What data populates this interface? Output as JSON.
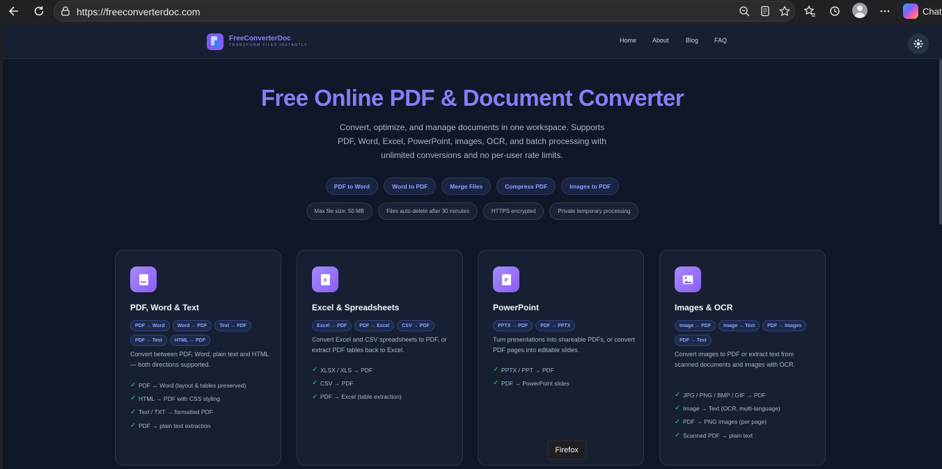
{
  "browser": {
    "url": "https://freeconverterdoc.com",
    "chat_label": "Chat"
  },
  "site": {
    "brand_name": "FreeConverterDoc",
    "brand_tagline": "TRANSFORM FILES INSTANTLY",
    "nav": [
      "Home",
      "About",
      "Blog",
      "FAQ"
    ]
  },
  "hero": {
    "title": "Free Online PDF & Document Converter",
    "subtitle": "Convert, optimize, and manage documents in one workspace. Supports PDF, Word, Excel, PowerPoint, images, OCR, and batch processing with unlimited conversions and no per-user rate limits.",
    "quick_links": [
      "PDF to Word",
      "Word to PDF",
      "Merge Files",
      "Compress PDF",
      "Images to PDF"
    ],
    "info_pills": [
      "Max file size: 50 MB",
      "Files auto-delete after 30 minutes",
      "HTTPS encrypted",
      "Private temporary processing"
    ]
  },
  "cards": [
    {
      "icon": "pdf-file-icon",
      "icon_text": "PDF",
      "title": "PDF, Word & Text",
      "tags": [
        "PDF → Word",
        "Word → PDF",
        "Text → PDF",
        "PDF → Text",
        "HTML → PDF"
      ],
      "description": "Convert between PDF, Word, plain text and HTML — both directions supported.",
      "features": [
        "PDF ↔ Word (layout & tables preserved)",
        "HTML → PDF with CSS styling",
        "Text / TXT → formatted PDF",
        "PDF → plain text extraction"
      ]
    },
    {
      "icon": "excel-file-icon",
      "icon_text": "X",
      "title": "Excel & Spreadsheets",
      "tags": [
        "Excel → PDF",
        "PDF → Excel",
        "CSV → PDF"
      ],
      "description": "Convert Excel and CSV spreadsheets to PDF, or extract PDF tables back to Excel.",
      "features": [
        "XLSX / XLS → PDF",
        "CSV → PDF",
        "PDF → Excel (table extraction)"
      ]
    },
    {
      "icon": "powerpoint-file-icon",
      "icon_text": "P",
      "title": "PowerPoint",
      "tags": [
        "PPTX → PDF",
        "PDF → PPTX"
      ],
      "description": "Turn presentations into shareable PDFs, or convert PDF pages into editable slides.",
      "features": [
        "PPTX / PPT → PDF",
        "PDF → PowerPoint slides"
      ]
    },
    {
      "icon": "image-icon",
      "icon_text": "",
      "title": "Images & OCR",
      "tags": [
        "Image → PDF",
        "Image → Text",
        "PDF → Images",
        "PDF → Text"
      ],
      "description": "Convert images to PDF or extract text from scanned documents and images with OCR.",
      "features": [
        "JPG / PNG / BMP / GIF → PDF",
        "Image → Text (OCR, multi-language)",
        "PDF → PNG images (per page)",
        "Scanned PDF → plain text"
      ]
    }
  ],
  "tooltip": "Firefox",
  "colors": {
    "page_bg": "#0f1729",
    "accent": "#8b7cf6",
    "check": "#22c55e"
  }
}
